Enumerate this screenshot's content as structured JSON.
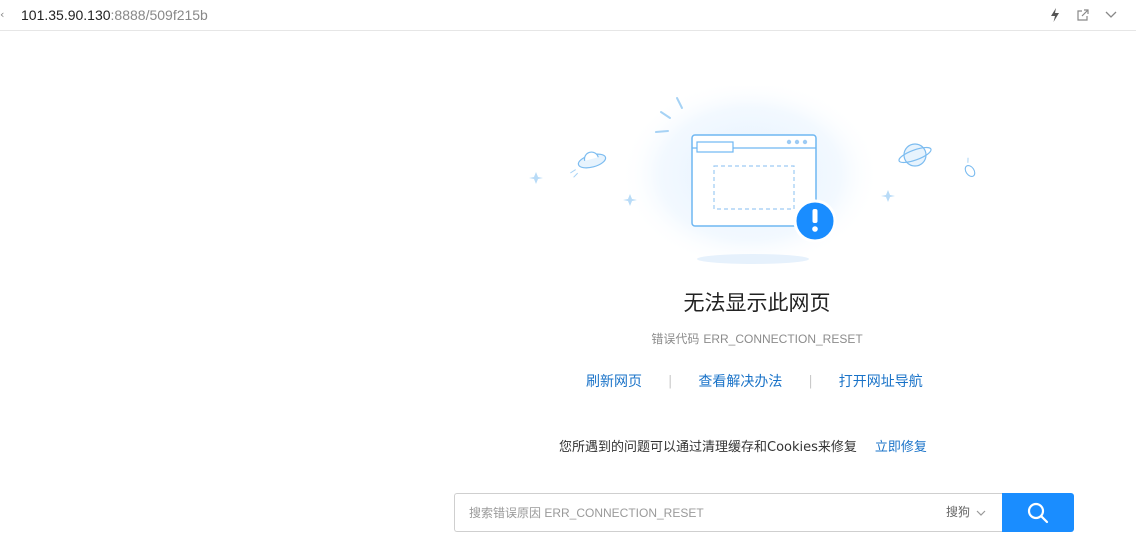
{
  "address_bar": {
    "url_host": "101.35.90.130",
    "url_rest": ":8888/509f215b",
    "icons": [
      "lightning-icon",
      "share-icon",
      "chevron-down-icon"
    ]
  },
  "illustration": {
    "icons": [
      "browser-window-icon",
      "error-exclamation-icon",
      "ufo-icon",
      "planet-icon",
      "rocket-icon",
      "sparkle-icon"
    ],
    "badge_glyph": "!",
    "colors": {
      "accent": "#1a8dff",
      "outline": "#6fb7f2",
      "glow": "#e9f4fe"
    }
  },
  "error": {
    "title": "无法显示此网页",
    "code_label": "错误代码",
    "code_value": "ERR_CONNECTION_RESET"
  },
  "actions": {
    "refresh": "刷新网页",
    "solutions": "查看解决办法",
    "nav": "打开网址导航",
    "separator": "|"
  },
  "hint": {
    "text": "您所遇到的问题可以通过清理缓存和Cookies来修复",
    "repair_link": "立即修复"
  },
  "search": {
    "placeholder": "搜索错误原因 ERR_CONNECTION_RESET",
    "engine": "搜狗",
    "button_icon": "search-icon"
  },
  "colors": {
    "link": "#1a73c8",
    "button": "#1a8dff"
  }
}
